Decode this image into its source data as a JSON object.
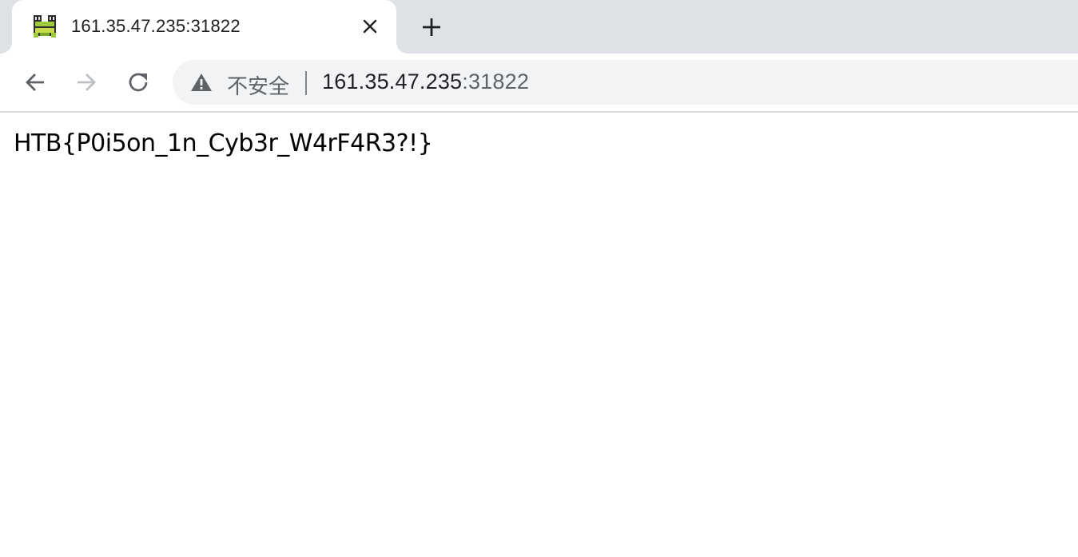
{
  "browser": {
    "tab": {
      "title": "161.35.47.235:31822",
      "favicon": "frog-icon"
    },
    "new_tab_icon": "plus-icon",
    "close_tab_icon": "close-icon",
    "nav": {
      "back_icon": "arrow-left-icon",
      "forward_icon": "arrow-right-icon",
      "reload_icon": "reload-icon"
    },
    "omnibox": {
      "security_icon": "warning-icon",
      "security_label": "不安全",
      "url_host": "161.35.47.235",
      "url_port": ":31822"
    }
  },
  "page": {
    "body_text": "HTB{P0i5on_1n_Cyb3r_W4rF4R3?!}"
  },
  "colors": {
    "tabstrip": "#dee1e6",
    "omnibox": "#f1f3f4",
    "text": "#202124",
    "muted": "#5f6368"
  }
}
